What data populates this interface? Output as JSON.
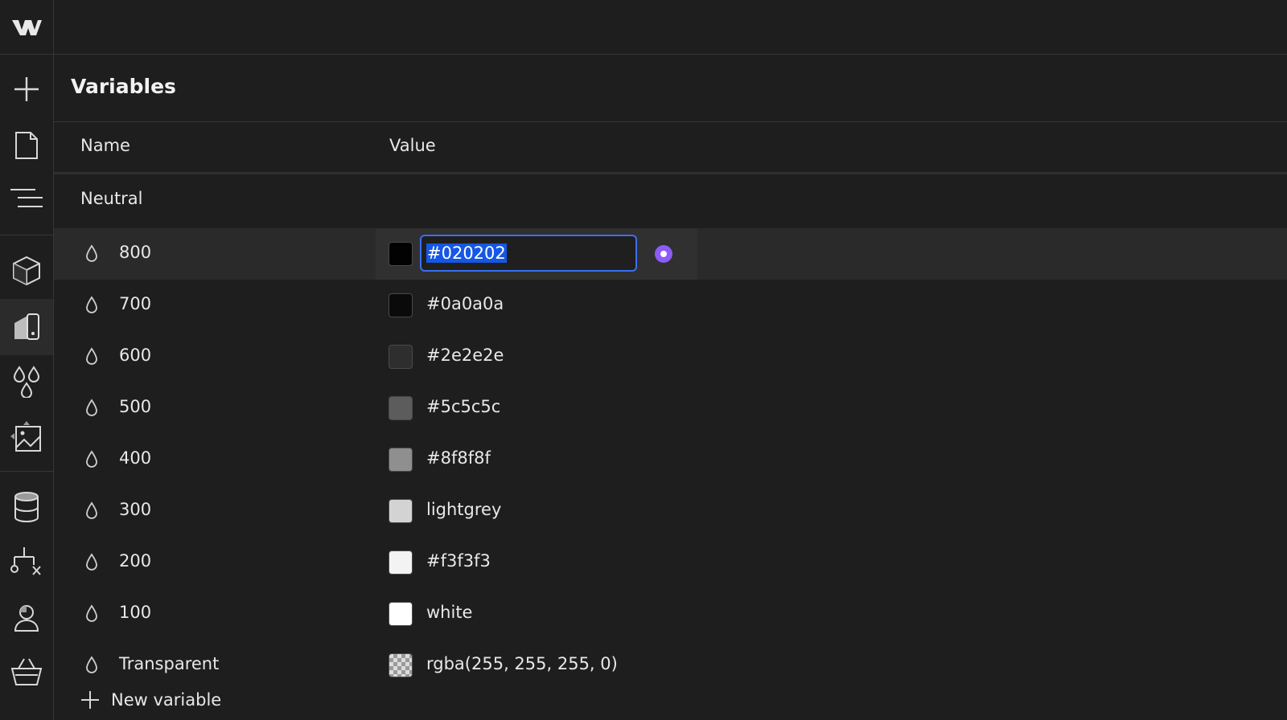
{
  "panel": {
    "title": "Variables",
    "columns": {
      "name": "Name",
      "value": "Value"
    },
    "group": "Neutral",
    "new_variable_label": "New variable"
  },
  "rows": [
    {
      "name": "800",
      "value": "#020202",
      "swatch": "#020202",
      "selected": true
    },
    {
      "name": "700",
      "value": "#0a0a0a",
      "swatch": "#0a0a0a"
    },
    {
      "name": "600",
      "value": "#2e2e2e",
      "swatch": "#2e2e2e"
    },
    {
      "name": "500",
      "value": "#5c5c5c",
      "swatch": "#5c5c5c"
    },
    {
      "name": "400",
      "value": "#8f8f8f",
      "swatch": "#8f8f8f"
    },
    {
      "name": "300",
      "value": "lightgrey",
      "swatch": "#d3d3d3"
    },
    {
      "name": "200",
      "value": "#f3f3f3",
      "swatch": "#f3f3f3"
    },
    {
      "name": "100",
      "value": "white",
      "swatch": "#ffffff"
    },
    {
      "name": "Transparent",
      "value": "rgba(255, 255, 255, 0)",
      "swatch": "checker"
    }
  ],
  "rail": {
    "items": [
      "webflow-logo",
      "add-icon",
      "pages-icon",
      "navigator-icon",
      "components-icon",
      "style-manager-icon",
      "variables-icon",
      "assets-icon",
      "cms-icon",
      "logic-icon",
      "users-icon",
      "ecommerce-icon"
    ],
    "active": "style-manager-icon"
  },
  "colors": {
    "background": "#1e1e1e",
    "selected_row": "#2a2a2a",
    "input_focus": "#3a6ff0",
    "text_selection": "#1557e6",
    "accent_dot": "#8c5cf5"
  }
}
